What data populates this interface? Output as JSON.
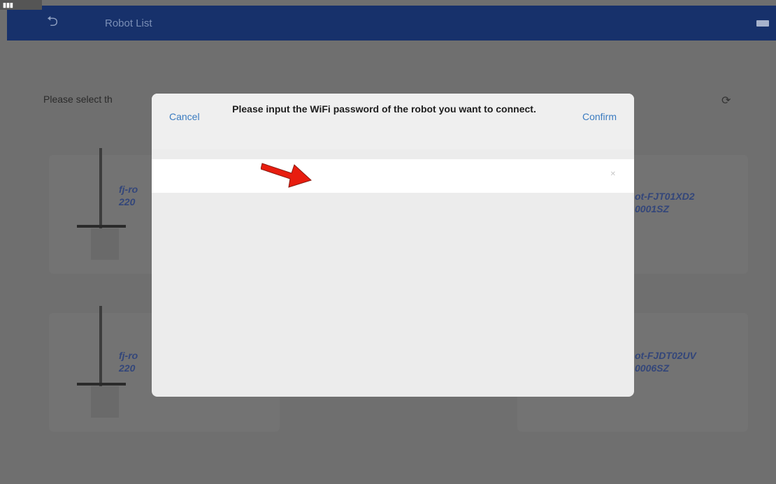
{
  "statusbar": {
    "left_text": "..."
  },
  "header": {
    "back_icon": "back-arrow-icon",
    "title": "Robot List"
  },
  "page": {
    "prompt": "Please select th",
    "refresh_icon": "refresh-icon"
  },
  "robots": [
    {
      "name_line1": "fj-ro",
      "name_line2": "220"
    },
    {
      "name_line1": "ot-FJT01XD2",
      "name_line2": "0001SZ"
    },
    {
      "name_line1": "fj-ro",
      "name_line2": "220"
    },
    {
      "name_line1": "ot-FJDT02UV",
      "name_line2": "0006SZ"
    }
  ],
  "dialog": {
    "cancel_label": "Cancel",
    "confirm_label": "Confirm",
    "title": "Please input the WiFi password of the robot you want to connect.",
    "input_value": "",
    "clear_icon": "clear-icon"
  },
  "colors": {
    "header_bg": "#17316b",
    "accent": "#3a7bc0",
    "arrow": "#e81d0f"
  }
}
